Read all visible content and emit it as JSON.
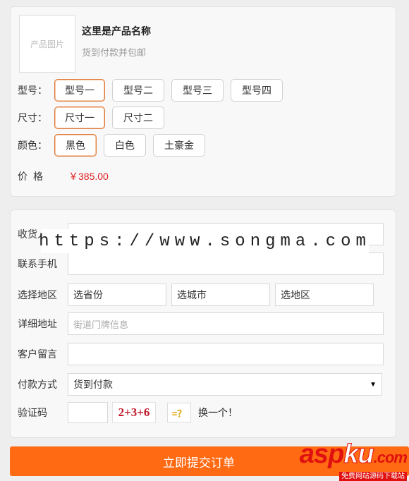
{
  "product": {
    "image_placeholder": "产品图片",
    "name": "这里是产品名称",
    "subtitle": "货到付款并包邮"
  },
  "options": {
    "model": {
      "label": "型号：",
      "choices": [
        "型号一",
        "型号二",
        "型号三",
        "型号四"
      ],
      "selected": "型号一"
    },
    "size": {
      "label": "尺寸：",
      "choices": [
        "尺寸一",
        "尺寸二"
      ],
      "selected": "尺寸一"
    },
    "color": {
      "label": "颜色：",
      "choices": [
        "黑色",
        "白色",
        "土豪金"
      ],
      "selected": "黑色"
    }
  },
  "price": {
    "label": "价格",
    "value": "￥385.00"
  },
  "form": {
    "recipient_label": "收货人",
    "phone_label": "联系手机",
    "region_label": "选择地区",
    "province": "选省份",
    "city": "选城市",
    "district": "选地区",
    "address_label": "详细地址",
    "address_placeholder": "街道门牌信息",
    "message_label": "客户留言",
    "payment_label": "付款方式",
    "payment_selected": "货到付款",
    "captcha_label": "验证码",
    "captcha_text": "2+3+6",
    "captcha_equals": "=？",
    "captcha_refresh": "换一个！"
  },
  "watermark": "https://www.songma.com",
  "submit_label": "立即提交订单",
  "logo": {
    "part1": "asp",
    "part2": "ku",
    "part3": ".com",
    "tagline": "免费网站源码下载站"
  },
  "colors": {
    "accent": "#ff6a13",
    "price": "#dd2222",
    "selected_border": "#e07a3b"
  }
}
